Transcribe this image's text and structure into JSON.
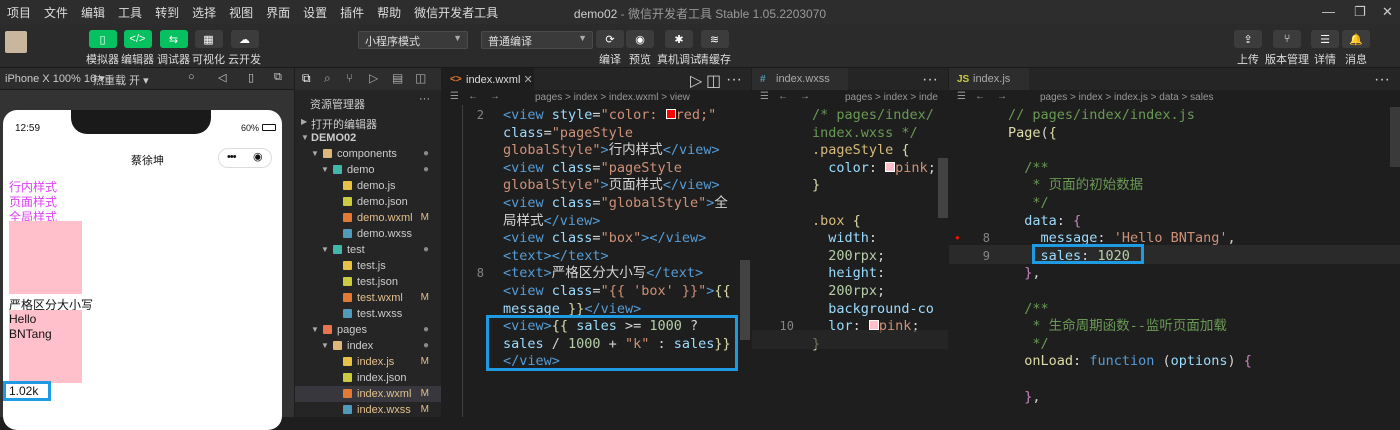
{
  "menu": [
    "项目",
    "文件",
    "编辑",
    "工具",
    "转到",
    "选择",
    "视图",
    "界面",
    "设置",
    "插件",
    "帮助",
    "微信开发者工具"
  ],
  "window_title": {
    "project": "demo02",
    "app": " - 微信开发者工具 Stable 1.05.2203070"
  },
  "toolbar": {
    "simulator": "模拟器",
    "editor": "编辑器",
    "debugger": "调试器",
    "visual": "可视化",
    "cloud": "云开发",
    "mode": "小程序模式",
    "compile_mode": "普通编译",
    "compile": "编译",
    "preview": "预览",
    "real_debug": "真机调试",
    "clear_cache": "清缓存",
    "upload": "上传",
    "version": "版本管理",
    "details": "详情",
    "messages": "消息"
  },
  "device": {
    "model": "iPhone X 100% 16 ▾",
    "hotreload": "热重载 开 ▾"
  },
  "phone": {
    "time": "12:59",
    "battery": "60%",
    "title": "蔡徐坤",
    "lines": {
      "inline": "行内样式",
      "page": "页面样式",
      "global": "全局样式",
      "strict": "严格区分大小写",
      "hello": "Hello",
      "name": "BNTang",
      "sales": "1.02k"
    },
    "colors": {
      "magenta": "#e040fb",
      "pink": "#ffc0cb"
    }
  },
  "explorer": {
    "header": "资源管理器",
    "open_editors": "打开的编辑器",
    "project": "DEMO02",
    "items": [
      {
        "label": "components",
        "depth": 1,
        "kind": "folder",
        "open": true,
        "status": "●"
      },
      {
        "label": "demo",
        "depth": 2,
        "kind": "folder-teal",
        "open": true,
        "status": "●"
      },
      {
        "label": "demo.js",
        "depth": 3,
        "kind": "js",
        "status": ""
      },
      {
        "label": "demo.json",
        "depth": 3,
        "kind": "json",
        "status": ""
      },
      {
        "label": "demo.wxml",
        "depth": 3,
        "kind": "wxml",
        "status": "M"
      },
      {
        "label": "demo.wxss",
        "depth": 3,
        "kind": "wxss",
        "status": ""
      },
      {
        "label": "test",
        "depth": 2,
        "kind": "folder-teal",
        "open": true,
        "status": "●"
      },
      {
        "label": "test.js",
        "depth": 3,
        "kind": "js",
        "status": ""
      },
      {
        "label": "test.json",
        "depth": 3,
        "kind": "json",
        "status": ""
      },
      {
        "label": "test.wxml",
        "depth": 3,
        "kind": "wxml",
        "status": "M"
      },
      {
        "label": "test.wxss",
        "depth": 3,
        "kind": "wxss",
        "status": ""
      },
      {
        "label": "pages",
        "depth": 1,
        "kind": "folder-red",
        "open": true,
        "status": "●"
      },
      {
        "label": "index",
        "depth": 2,
        "kind": "folder",
        "open": true,
        "status": "●"
      },
      {
        "label": "index.js",
        "depth": 3,
        "kind": "js",
        "status": "M"
      },
      {
        "label": "index.json",
        "depth": 3,
        "kind": "json",
        "status": ""
      },
      {
        "label": "index.wxml",
        "depth": 3,
        "kind": "wxml",
        "status": "M",
        "selected": true
      },
      {
        "label": "index.wxss",
        "depth": 3,
        "kind": "wxss",
        "status": "M"
      }
    ]
  },
  "editors": {
    "wxml": {
      "tab": "index.wxml",
      "breadcrumb": [
        "pages",
        ">",
        "index",
        ">",
        "index.wxml",
        ">",
        "view"
      ],
      "line_numbers": [
        "2",
        "",
        "",
        "",
        "",
        "",
        "",
        "",
        "",
        "8",
        "",
        "",
        ""
      ]
    },
    "wxss": {
      "tab": "index.wxss",
      "breadcrumb": [
        "pages",
        ">",
        "index",
        ">",
        "inde"
      ],
      "line_numbers": [
        "",
        "",
        "",
        "",
        "",
        "",
        "",
        "",
        "",
        "",
        "",
        "",
        "10"
      ]
    },
    "js": {
      "tab": "index.js",
      "breadcrumb": [
        "pages",
        ">",
        "index",
        ">",
        "index.js",
        ">",
        "data",
        ">",
        "sales"
      ],
      "line_numbers": [
        "",
        "",
        "",
        "",
        "",
        "",
        "",
        "8",
        "9",
        "",
        "",
        "",
        "",
        "",
        "",
        ""
      ]
    }
  }
}
